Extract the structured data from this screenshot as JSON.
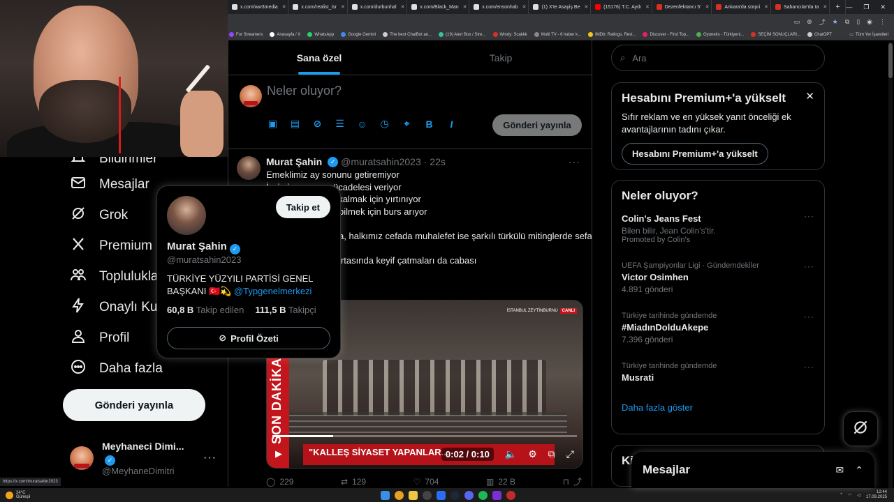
{
  "browser": {
    "tabs": [
      {
        "label": "x.com/ww3media",
        "color": "#e0e0e0"
      },
      {
        "label": "x.com/realist_isr",
        "color": "#e0e0e0"
      },
      {
        "label": "x.com/durbunhal",
        "color": "#e0e0e0"
      },
      {
        "label": "x.com/Black_Man",
        "color": "#e0e0e0"
      },
      {
        "label": "x.com/ensonhab",
        "color": "#e0e0e0"
      },
      {
        "label": "(1) X'te Asayiş Be",
        "color": "#e0e0e0"
      },
      {
        "label": "(15176) T.C. Aydı",
        "color": "#ff0000"
      },
      {
        "label": "Dezenfektancı 5'",
        "color": "#d93025"
      },
      {
        "label": "Ankara'da sürpri",
        "color": "#d93025"
      },
      {
        "label": "Sabancılar'da ta",
        "color": "#d93025"
      }
    ],
    "new_tab": "+",
    "bookmarks": [
      {
        "label": "For Streamers",
        "color": "#9146ff"
      },
      {
        "label": "Anasayfa / X",
        "color": "#ffffff"
      },
      {
        "label": "WhatsApp",
        "color": "#25d366"
      },
      {
        "label": "Google Gemini",
        "color": "#4285f4"
      },
      {
        "label": "The best ChatBot an...",
        "color": "#cccccc"
      },
      {
        "label": "(19) Alert Box / Stre...",
        "color": "#31c3a2"
      },
      {
        "label": "Windy: Scakkk",
        "color": "#d93025"
      },
      {
        "label": "Multi TV - 6 haber k...",
        "color": "#888888"
      },
      {
        "label": "IMDb: Ratings, Revi...",
        "color": "#f5c518"
      },
      {
        "label": "Discover - Find Top...",
        "color": "#e91e63"
      },
      {
        "label": "Oyuneks - Türkiyeni...",
        "color": "#4caf50"
      },
      {
        "label": "SEÇİM SONUÇLARI...",
        "color": "#d93025"
      },
      {
        "label": "ChatGPT",
        "color": "#cccccc"
      }
    ],
    "all_bookmarks": "Tüm Yer İşaretleri"
  },
  "nav": {
    "items": [
      {
        "label": "Bildirimler",
        "icon": "bell-icon"
      },
      {
        "label": "Mesajlar",
        "icon": "mail-icon"
      },
      {
        "label": "Grok",
        "icon": "grok-icon"
      },
      {
        "label": "Premium",
        "icon": "x-logo-icon"
      },
      {
        "label": "Topluluklar",
        "icon": "communities-icon"
      },
      {
        "label": "Onaylı Kuruluşlar",
        "icon": "lightning-icon"
      },
      {
        "label": "Profil",
        "icon": "person-icon"
      },
      {
        "label": "Daha fazla",
        "icon": "more-circle-icon"
      }
    ],
    "post_button": "Gönderi yayınla",
    "account": {
      "name": "Meyhaneci Dimi...",
      "handle": "@MeyhaneDimitri"
    }
  },
  "main": {
    "tabs": [
      {
        "label": "Sana özel"
      },
      {
        "label": "Takip"
      }
    ],
    "compose_placeholder": "Neler oluyor?",
    "compose_post_button": "Gönderi yayınla",
    "tweet": {
      "author": "Murat Şahin",
      "handle": "@muratsahin2023",
      "time": "· 22s",
      "lines": [
        "Emeklimiz ay sonunu getiremiyor",
        "İşçimiz yaşam mücadelesi veriyor",
        "Esnafımız ayakta kalmak için yırtınıyor",
        "Öğrencimiz okuyabilmek için burs arıyor",
        "",
        "Gençlerimiz cefada, halkımız cefada muhalefet ise şarkılı türkülü mitinglerde sefada",
        "",
        "Bu kötü gidişatın ortasında keyif çatmaları da cabası"
      ],
      "video": {
        "band": "SON DAKİKA",
        "headline": "\"KALLEŞ SİYASET YAPANLAR...",
        "tag": "İSTANBUL ZEYTİNBURNU",
        "live": "CANLI",
        "time": "0:02 / 0:10",
        "progress": 0.2
      },
      "replies": "229",
      "reposts": "129",
      "likes": "704",
      "views": "22 B"
    }
  },
  "hovercard": {
    "follow": "Takip et",
    "name": "Murat Şahin",
    "handle": "@muratsahin2023",
    "bio": "TÜRKİYE YÜZYILI PARTİSİ GENEL BAŞKANI 🇹🇷💫",
    "bio_link": "@Typgenelmerkezi",
    "following_count": "60,8 B",
    "following_label": "Takip edilen",
    "followers_count": "111,5 B",
    "followers_label": "Takipçi",
    "summary_button": "Profil Özeti"
  },
  "right": {
    "search_placeholder": "Ara",
    "premium": {
      "title": "Hesabını Premium+'a yükselt",
      "body": "Sıfır reklam ve en yüksek yanıt önceliği ek avantajlarının tadını çıkar.",
      "button": "Hesabını Premium+'a yükselt"
    },
    "trends_title": "Neler oluyor?",
    "trends": [
      {
        "ctx": "",
        "name": "Colin's Jeans Fest",
        "meta": "Bilen bilir, Jean Colin's'tir.",
        "meta2": "Promoted by Colin's"
      },
      {
        "ctx": "UEFA Şampiyonlar Ligi · Gündemdekiler",
        "name": "Victor Osimhen",
        "meta": "4.891 gönderi",
        "meta2": ""
      },
      {
        "ctx": "Türkiye tarihinde gündemde",
        "name": "#MiadınDolduAkepe",
        "meta": "7.396 gönderi",
        "meta2": ""
      },
      {
        "ctx": "Türkiye tarihinde gündemde",
        "name": "Musrati",
        "meta": "",
        "meta2": ""
      }
    ],
    "show_more": "Daha fazla göster",
    "who_to_follow": "Ki",
    "messages_dock": "Mesajlar"
  },
  "status_url": "https://x.com/muratsahin2023",
  "taskbar": {
    "temp": "24°C",
    "weather": "Güneşli",
    "time": "12:44",
    "date": "17.09.2025"
  }
}
